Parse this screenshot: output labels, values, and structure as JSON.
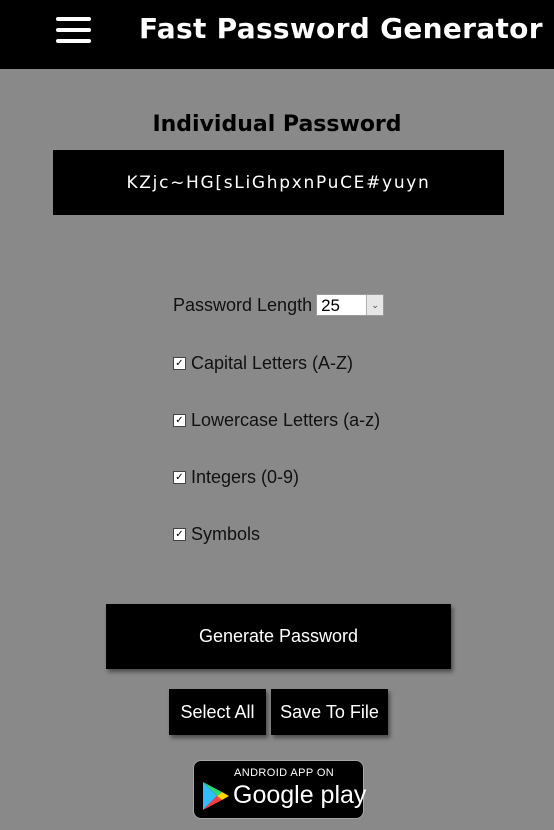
{
  "header": {
    "title": "Fast Password Generator",
    "menu_icon": "hamburger-menu-icon"
  },
  "main": {
    "section_title": "Individual Password",
    "password": "KZjc~HG[sLiGhpxnPuCE#yuyn"
  },
  "options": {
    "length_label": "Password Length",
    "length_value": "25",
    "checkboxes": [
      {
        "label": "Capital Letters (A-Z)",
        "checked": true
      },
      {
        "label": "Lowercase Letters (a-z)",
        "checked": true
      },
      {
        "label": "Integers (0-9)",
        "checked": true
      },
      {
        "label": "Symbols",
        "checked": true
      }
    ]
  },
  "buttons": {
    "generate": "Generate Password",
    "select_all": "Select All",
    "save_to_file": "Save To File"
  },
  "badge": {
    "top_text": "ANDROID APP ON",
    "bottom_text": "Google play"
  },
  "colors": {
    "background": "#898989",
    "header": "#000000",
    "button": "#000000"
  }
}
